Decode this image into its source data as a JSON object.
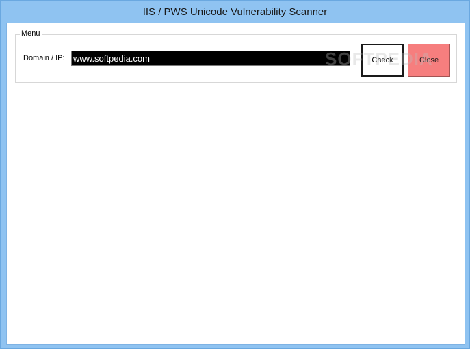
{
  "window": {
    "title": "IIS / PWS Unicode Vulnerability Scanner"
  },
  "menu": {
    "legend": "Menu",
    "domain_label": "Domain / IP:",
    "domain_value": "www.softpedia.com",
    "check_label": "Check",
    "close_label": "Close"
  },
  "watermark": "SOFTPEDIA",
  "colors": {
    "close_button": "#f67e7e",
    "input_background": "#000000",
    "title_bar": "#8fc3f1"
  }
}
